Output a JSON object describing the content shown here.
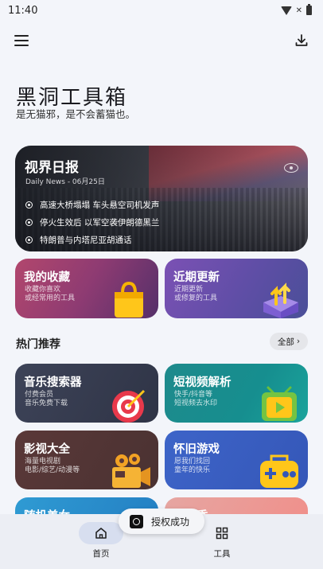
{
  "status": {
    "time": "11:40"
  },
  "hero": {
    "title": "黑洞工具箱",
    "subtitle": "是无猫邪，是不会蓄猫也。"
  },
  "news": {
    "title": "视界日报",
    "date": "Daily News - 06月25日",
    "items": [
      "高速大桥塌塌 车头悬空司机发声",
      "停火生效后 以军空袭伊朗德黑兰",
      "特朗普与内塔尼亚胡通话"
    ]
  },
  "tiles_top": [
    {
      "title": "我的收藏",
      "desc1": "收藏你喜欢",
      "desc2": "或经常用的工具",
      "icon": "shopping-bag-icon"
    },
    {
      "title": "近期更新",
      "desc1": "近期更新",
      "desc2": "或修复的工具",
      "icon": "update-box-icon"
    }
  ],
  "section": {
    "title": "热门推荐",
    "all_label": "全部"
  },
  "tiles_hot": [
    {
      "title": "音乐搜索器",
      "desc1": "付费会员",
      "desc2": "音乐免费下载",
      "icon": "target-icon"
    },
    {
      "title": "短视频解析",
      "desc1": "快手/抖音等",
      "desc2": "短视频去水印",
      "icon": "tv-icon"
    },
    {
      "title": "影视大全",
      "desc1": "海量电视剧",
      "desc2": "电影/综艺/动漫等",
      "icon": "film-camera-icon"
    },
    {
      "title": "怀旧游戏",
      "desc1": "愿我们找回",
      "desc2": "童年的快乐",
      "icon": "gamepad-icon"
    },
    {
      "title": "随机美女",
      "desc1": "",
      "desc2": "",
      "icon": ""
    },
    {
      "title": "福利秀",
      "desc1": "",
      "desc2": "",
      "icon": ""
    }
  ],
  "toast": {
    "text": "授权成功"
  },
  "nav": {
    "home": "首页",
    "tools": "工具"
  },
  "colors": {
    "accent": "#d7deef",
    "background": "#f3f5fa"
  }
}
